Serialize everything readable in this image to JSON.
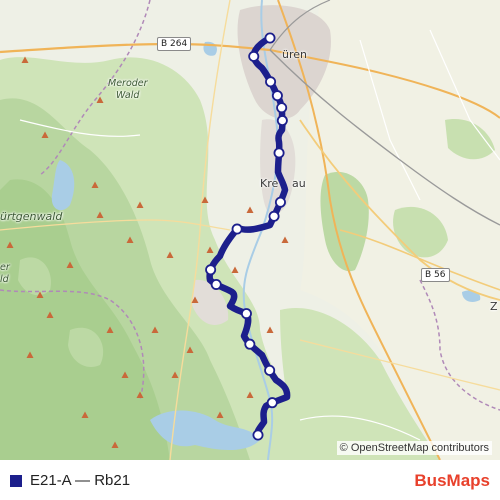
{
  "map": {
    "places": {
      "duren": "üren",
      "kreuzau": "Kre",
      "kreuzau_tail": "au",
      "meroder_wald_1": "Meroder",
      "meroder_wald_2": "Wald",
      "hurtgenwald": "ürtgenwald",
      "left_edge_1": "er",
      "left_edge_2": "ld",
      "right_edge": "Z"
    },
    "roads": {
      "b264": "B 264",
      "b56": "B 56"
    },
    "attribution": "© OpenStreetMap contributors"
  },
  "route": {
    "color": "#1c1f8c",
    "stop_count": 17
  },
  "legend": {
    "label": "E21-A — Rb21",
    "swatch_color": "#1c1f8c"
  },
  "brand": {
    "part1": "Bus",
    "part2": "Maps",
    "color": "#e8412c"
  }
}
